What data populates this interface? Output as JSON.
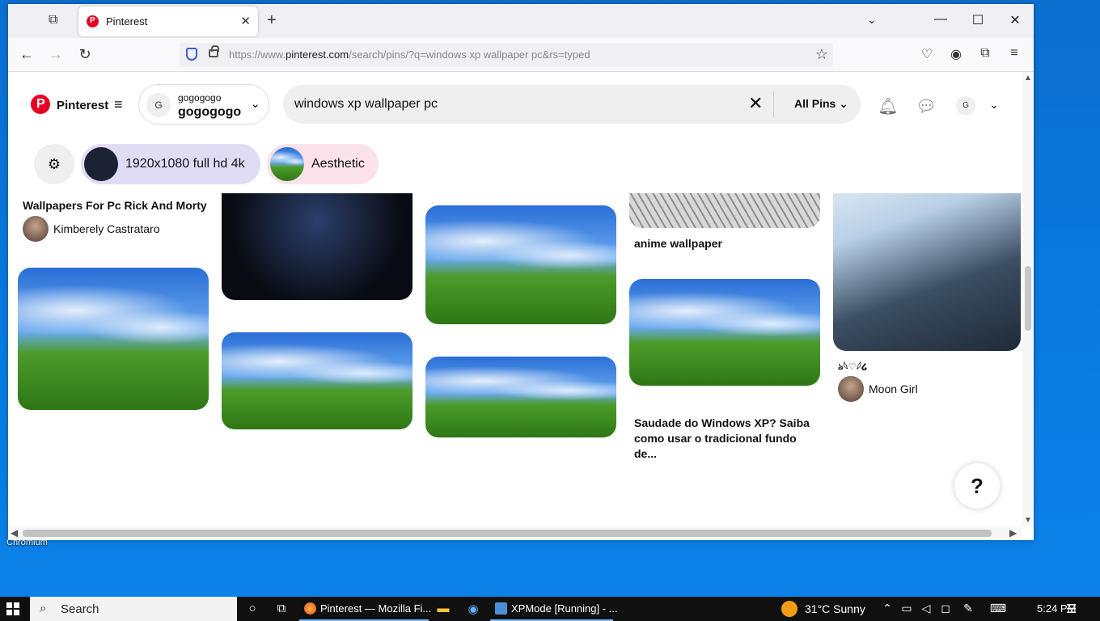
{
  "desktop": {
    "label": "Chromium"
  },
  "browser": {
    "tab": {
      "title": "Pinterest"
    },
    "url_prefix": "https://www.",
    "url_domain": "pinterest.com",
    "url_rest": "/search/pins/?q=windows xp wallpaper pc&rs=typed"
  },
  "pinterest": {
    "brand": "Pinterest",
    "account": {
      "avatar_letter": "G",
      "small": "gogogogo",
      "name": "gogogogo"
    },
    "search": {
      "value": "windows xp wallpaper pc",
      "filter": "All Pins"
    },
    "header_avatar": "G",
    "chips": [
      {
        "label": "1920x1080 full hd 4k"
      },
      {
        "label": "Aesthetic"
      }
    ],
    "pins": {
      "col1_title": "Wallpapers For Pc Rick And Morty",
      "col1_user": "Kimberely Castrataro",
      "col4_title": "anime wallpaper",
      "col4_title2": "Saudade do Windows XP? Saiba como usar o tradicional fundo de...",
      "col5_title": "ঌ𓆩♡𓆪໒",
      "col5_user": "Moon Girl"
    },
    "help": "?"
  },
  "taskbar": {
    "search": "Search",
    "apps": [
      {
        "label": "Pinterest — Mozilla Fi..."
      },
      {
        "label": "XPMode [Running] - ..."
      }
    ],
    "weather": "31°C  Sunny",
    "time": "5:24 PM"
  },
  "colors": {
    "pinterest_red": "#e60023",
    "taskbar": "#101010",
    "desktop": "#0a78d7"
  }
}
